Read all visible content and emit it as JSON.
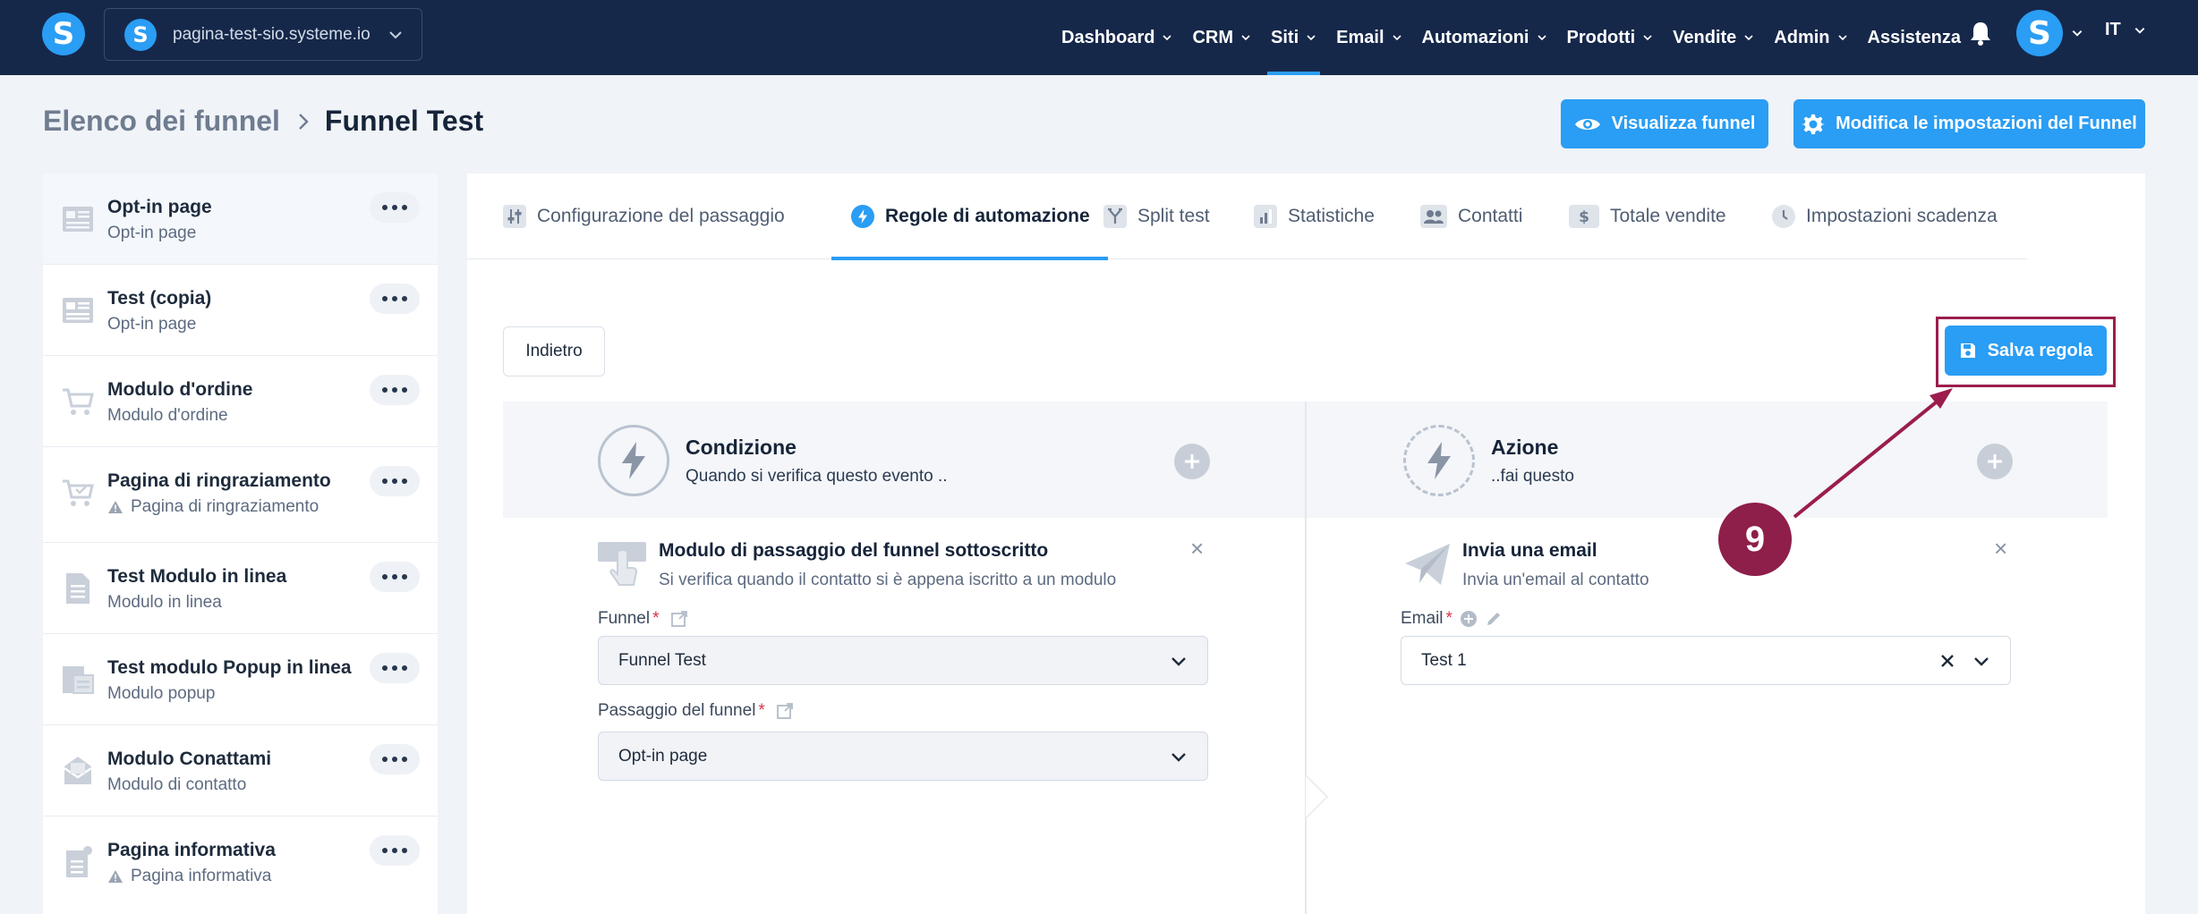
{
  "topnav": {
    "brand_letter": "S",
    "site_name": "pagina-test-sio.systeme.io",
    "menu": [
      {
        "label": "Dashboard",
        "active": false
      },
      {
        "label": "CRM",
        "active": false
      },
      {
        "label": "Siti",
        "active": true
      },
      {
        "label": "Email",
        "active": false
      },
      {
        "label": "Automazioni",
        "active": false
      },
      {
        "label": "Prodotti",
        "active": false
      },
      {
        "label": "Vendite",
        "active": false
      },
      {
        "label": "Admin",
        "active": false
      },
      {
        "label": "Assistenza",
        "active": false
      }
    ],
    "avatar_letter": "S",
    "language": "IT"
  },
  "header": {
    "breadcrumb_parent": "Elenco dei funnel",
    "breadcrumb_current": "Funnel Test",
    "view_funnel_label": "Visualizza funnel",
    "edit_funnel_label": "Modifica le impostazioni del Funnel"
  },
  "sidebar": {
    "steps": [
      {
        "title": "Opt-in page",
        "subtitle": "Opt-in page",
        "warning": false,
        "icon": "page-layout-icon",
        "selected": true
      },
      {
        "title": "Test (copia)",
        "subtitle": "Opt-in page",
        "warning": false,
        "icon": "page-layout-icon",
        "selected": false
      },
      {
        "title": "Modulo d'ordine",
        "subtitle": "Modulo d'ordine",
        "warning": false,
        "icon": "cart-icon",
        "selected": false
      },
      {
        "title": "Pagina di ringraziamento",
        "subtitle": "Pagina di ringraziamento",
        "warning": true,
        "icon": "cart-check-icon",
        "selected": false
      },
      {
        "title": "Test Modulo in linea",
        "subtitle": "Modulo in linea",
        "warning": false,
        "icon": "document-icon",
        "selected": false
      },
      {
        "title": "Test modulo Popup in linea",
        "subtitle": "Modulo popup",
        "warning": false,
        "icon": "popup-icon",
        "selected": false
      },
      {
        "title": "Modulo Conattami",
        "subtitle": "Modulo di contatto",
        "warning": false,
        "icon": "inbox-icon",
        "selected": false
      },
      {
        "title": "Pagina informativa",
        "subtitle": "Pagina informativa",
        "warning": true,
        "icon": "info-page-icon",
        "selected": false
      }
    ]
  },
  "tabs": [
    {
      "label": "Configurazione del passaggio",
      "icon": "sliders-icon",
      "active": false
    },
    {
      "label": "Regole di automazione",
      "icon": "bolt-icon",
      "active": true
    },
    {
      "label": "Split test",
      "icon": "split-icon",
      "active": false
    },
    {
      "label": "Statistiche",
      "icon": "bar-chart-icon",
      "active": false
    },
    {
      "label": "Contatti",
      "icon": "users-icon",
      "active": false
    },
    {
      "label": "Totale vendite",
      "icon": "dollar-icon",
      "active": false
    },
    {
      "label": "Impostazioni scadenza",
      "icon": "clock-icon",
      "active": false
    }
  ],
  "rule": {
    "back_label": "Indietro",
    "save_label": "Salva regola",
    "condition": {
      "title": "Condizione",
      "subtitle": "Quando si verifica questo evento ..",
      "trigger_title": "Modulo di passaggio del funnel sottoscritto",
      "trigger_desc": "Si verifica quando il contatto si è appena iscritto a un modulo",
      "funnel_label": "Funnel",
      "funnel_value": "Funnel Test",
      "step_label": "Passaggio del funnel",
      "step_value": "Opt-in page"
    },
    "action": {
      "title": "Azione",
      "subtitle": "..fai questo",
      "action_title": "Invia una email",
      "action_desc": "Invia un'email al contatto",
      "email_label": "Email",
      "email_value": "Test 1"
    }
  },
  "annotation": {
    "step_number": "9"
  },
  "colors": {
    "nav_bg": "#16284a",
    "accent": "#2a9df4",
    "annotation": "#9b1d4d"
  }
}
